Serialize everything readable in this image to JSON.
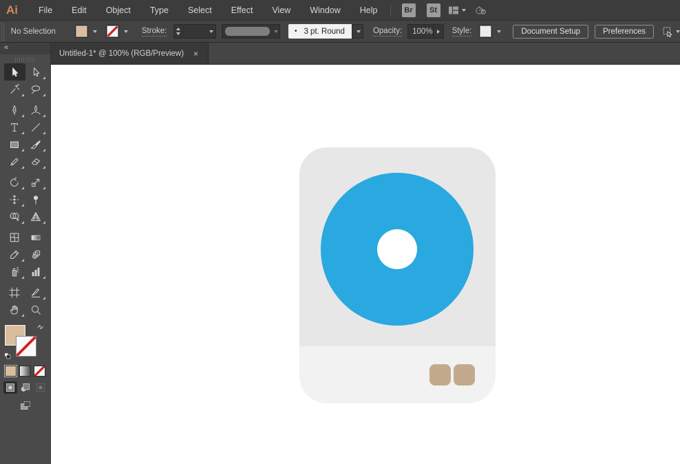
{
  "app": {
    "logo": "Ai",
    "logo_color": "#D5885A"
  },
  "menubar": {
    "items": [
      "File",
      "Edit",
      "Object",
      "Type",
      "Select",
      "Effect",
      "View",
      "Window",
      "Help"
    ],
    "badges": [
      {
        "label": "Br"
      },
      {
        "label": "St"
      }
    ]
  },
  "controlbar": {
    "selection_status": "No Selection",
    "stroke_label": "Stroke:",
    "stroke_weight_value": "",
    "brush_bullet": "•",
    "brush_name": "3 pt. Round",
    "opacity_label": "Opacity:",
    "opacity_value": "100%",
    "style_label": "Style:",
    "document_setup_label": "Document Setup",
    "preferences_label": "Preferences"
  },
  "tabbar": {
    "tabs": [
      {
        "title": "Untitled-1* @ 100% (RGB/Preview)",
        "close": "×"
      }
    ]
  },
  "toolbar": {
    "collapse_glyph": "«",
    "groups": [
      [
        "selection-tool",
        "direct-selection-tool",
        "magic-wand-tool",
        "lasso-tool"
      ],
      [
        "pen-tool",
        "curvature-tool",
        "type-tool",
        "line-segment-tool",
        "rectangle-tool",
        "paintbrush-tool",
        "shaper-tool",
        "eraser-tool"
      ],
      [
        "rotate-tool",
        "scale-tool",
        "width-tool",
        "puppet-warp-tool",
        "shape-builder-tool",
        "perspective-grid-tool"
      ],
      [
        "mesh-tool",
        "gradient-tool",
        "eyedropper-tool",
        "blend-tool",
        "symbol-sprayer-tool",
        "column-graph-tool"
      ],
      [
        "artboard-tool",
        "slice-tool",
        "hand-tool",
        "zoom-tool"
      ]
    ],
    "active_tool": "selection-tool",
    "flyout_tools": [
      "direct-selection-tool",
      "magic-wand-tool",
      "lasso-tool",
      "pen-tool",
      "curvature-tool",
      "type-tool",
      "line-segment-tool",
      "rectangle-tool",
      "paintbrush-tool",
      "shaper-tool",
      "eraser-tool",
      "rotate-tool",
      "scale-tool",
      "width-tool",
      "shape-builder-tool",
      "perspective-grid-tool",
      "eyedropper-tool",
      "symbol-sprayer-tool",
      "column-graph-tool",
      "slice-tool",
      "hand-tool"
    ]
  },
  "colors": {
    "fill_swatch": "#D8BD9E",
    "ui_bar": "#3C3C3C"
  },
  "artwork": {
    "card_top_color": "#E7E7E7",
    "card_bottom_color": "#F2F2F2",
    "disc_color": "#29A9E0",
    "hole_color": "#FFFFFF",
    "button_color": "#C4AA8D"
  }
}
